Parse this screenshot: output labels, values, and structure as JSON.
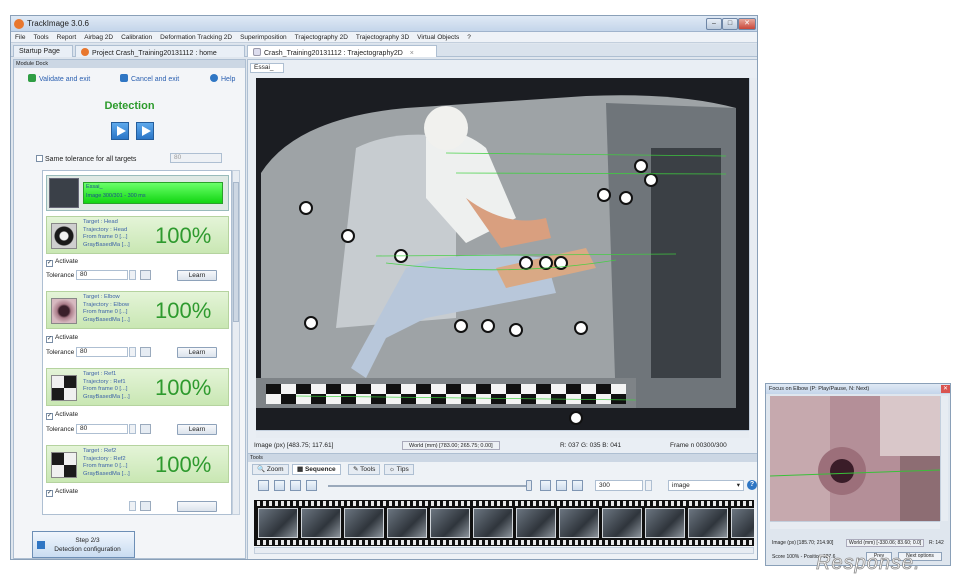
{
  "window": {
    "title": "TrackImage 3.0.6",
    "controls": [
      "–",
      "□",
      "✕"
    ]
  },
  "menu": [
    "File",
    "Tools",
    "Report",
    "Airbag 2D",
    "Calibration",
    "Deformation Tracking 2D",
    "Superimposition",
    "Trajectography 2D",
    "Trajectography 3D",
    "Virtual Objects",
    "?"
  ],
  "doc_tabs": [
    {
      "label": "Startup Page"
    },
    {
      "label": "Project Crash_Training20131112 : home"
    },
    {
      "label": "Crash_Training20131112 : Trajectography2D",
      "close": "×"
    }
  ],
  "left_panel": {
    "header": "Module Dock",
    "validate": "Validate and exit",
    "cancel": "Cancel and exit",
    "help": "Help",
    "detection_title": "Detection",
    "same_tolerance": "Same tolerance for all targets",
    "same_tolerance_value": "80",
    "essai": {
      "name": "Essai_",
      "image_info": "Image 300/301 - 300 ms"
    },
    "targets": [
      {
        "target": "Target : Head",
        "trajectory": "Trajectory : Head",
        "from": "From frame 0 [...]",
        "method": "GrayBasedMa [...]",
        "score": "100%",
        "activate": "Activate",
        "tolerance_label": "Tolerance",
        "tolerance": "80",
        "learn": "Learn"
      },
      {
        "target": "Target : Elbow",
        "trajectory": "Trajectory : Elbow",
        "from": "From frame 0 [...]",
        "method": "GrayBasedMa [...]",
        "score": "100%",
        "activate": "Activate",
        "tolerance_label": "Tolerance",
        "tolerance": "80",
        "learn": "Learn"
      },
      {
        "target": "Target : Ref1",
        "trajectory": "Trajectory : Ref1",
        "from": "From frame 0 [...]",
        "method": "GrayBasedMa [...]",
        "score": "100%",
        "activate": "Activate",
        "tolerance_label": "Tolerance",
        "tolerance": "80",
        "learn": "Learn"
      },
      {
        "target": "Target : Ref2",
        "trajectory": "Trajectory : Ref2",
        "from": "From frame 0 [...]",
        "method": "GrayBasedMa [...]",
        "score": "100%",
        "activate": "Activate"
      }
    ],
    "step_line1": "Step 2/3",
    "step_line2": "Detection configuration"
  },
  "viewer": {
    "tab": "Essai_",
    "image_coords": "Image (px) [483.75; 117.61]",
    "world_coords": "World (mm) [783.00; 265.75;  0.00]",
    "rgb": "R: 037 G: 035 B: 041",
    "frame": "Frame n 00300/300"
  },
  "tools": {
    "header": "Tools",
    "tabs": [
      "Zoom",
      "Sequence",
      "Tools",
      "Tips"
    ],
    "frame_value": "300",
    "mode": "image",
    "help": "?"
  },
  "focus": {
    "title": "Focus on Elbow (P: Play/Pause, N: Next)",
    "close": "✕",
    "image_coords": "Image (px) [185.70; 214.90]",
    "world_coords": "World (mm) [-330.06; 83.60;  0.0]",
    "r_value": "R: 142",
    "score": "Score 100% - Position 187.6",
    "btn1": "Prev",
    "btn2": "Next options"
  },
  "watermark": "Response."
}
